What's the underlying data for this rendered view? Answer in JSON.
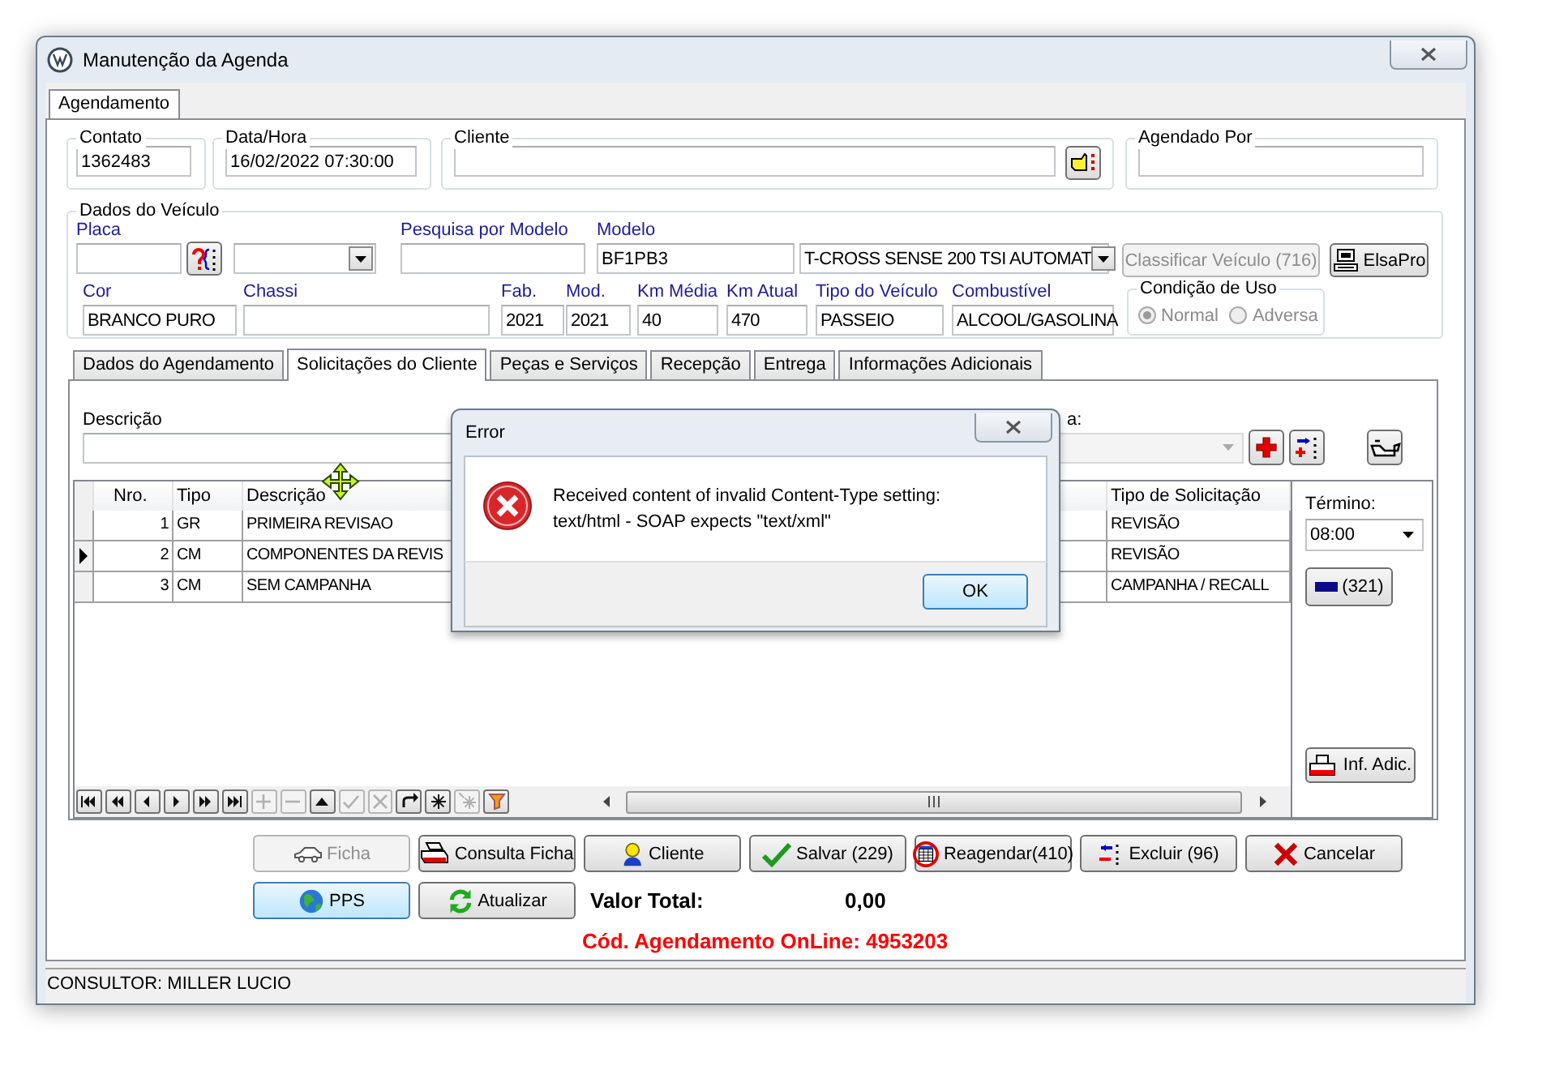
{
  "window": {
    "title": "Manutenção da Agenda"
  },
  "tabs": [
    {
      "label": "Agendamento",
      "selected": true
    }
  ],
  "contato": {
    "label": "Contato",
    "value": "1362483"
  },
  "data_hora": {
    "label": "Data/Hora",
    "value": "16/02/2022 07:30:00"
  },
  "cliente": {
    "label": "Cliente"
  },
  "agendado_por": {
    "label": "Agendado Por"
  },
  "vehicle": {
    "title": "Dados do Veículo",
    "placa": {
      "label": "Placa"
    },
    "pesquisa_modelo": {
      "label": "Pesquisa por Modelo"
    },
    "modelo": {
      "label": "Modelo",
      "value": "BF1PB3"
    },
    "modelo_descricao": {
      "value": "T-CROSS SENSE 200 TSI AUTOMAT"
    },
    "classificar_button": {
      "label": "Classificar Veículo (716)",
      "disabled": true
    },
    "elsapro_button": {
      "label": "ElsaPro",
      "disabled": false
    },
    "fields": [
      {
        "label": "Cor",
        "value": "BRANCO PURO"
      },
      {
        "label": "Chassi"
      },
      {
        "label": "Fab.",
        "value": "2021"
      },
      {
        "label": "Mod.",
        "value": "2021"
      },
      {
        "label": "Km Média",
        "value": "40"
      },
      {
        "label": "Km Atual",
        "value": "470"
      },
      {
        "label": "Tipo do Veículo",
        "value": "PASSEIO"
      },
      {
        "label": "Combustível",
        "value": "ALCOOL/GASOLINA"
      }
    ],
    "condicao_uso": {
      "title": "Condição de Uso",
      "disabled": true,
      "options": [
        {
          "label": "Normal",
          "selected": true
        },
        {
          "label": "Adversa",
          "selected": false
        }
      ]
    }
  },
  "sub_tabs": [
    {
      "label": "Dados do Agendamento",
      "selected": false
    },
    {
      "label": "Solicitações do Cliente",
      "selected": true
    },
    {
      "label": "Peças e Serviços",
      "selected": false
    },
    {
      "label": "Recepção",
      "selected": false
    },
    {
      "label": "Entrega",
      "selected": false
    },
    {
      "label": "Informações Adicionais",
      "selected": false
    }
  ],
  "solicitacoes": {
    "descricao_label": "Descrição",
    "right_label": "a:",
    "grid": {
      "columns": [
        "Nro.",
        "Tipo",
        "Descrição",
        "Tipo de Solicitação"
      ],
      "rows": [
        {
          "cells": [
            "1",
            "GR",
            "PRIMEIRA REVISAO",
            "REVISÃO"
          ],
          "current": false
        },
        {
          "cells": [
            "2",
            "CM",
            "COMPONENTES DA REVIS",
            "REVISÃO"
          ],
          "current": true
        },
        {
          "cells": [
            "3",
            "CM",
            "SEM CAMPANHA",
            "CAMPANHA / RECALL"
          ],
          "current": false
        }
      ]
    },
    "navigator": [
      {
        "kind": "first",
        "disabled": false
      },
      {
        "kind": "prior-page",
        "disabled": false
      },
      {
        "kind": "prior",
        "disabled": false
      },
      {
        "kind": "next",
        "disabled": false
      },
      {
        "kind": "next-page",
        "disabled": false
      },
      {
        "kind": "last",
        "disabled": false
      },
      {
        "kind": "insert",
        "disabled": true
      },
      {
        "kind": "delete",
        "disabled": true
      },
      {
        "kind": "edit",
        "disabled": false
      },
      {
        "kind": "post",
        "disabled": true
      },
      {
        "kind": "cancel",
        "disabled": true
      },
      {
        "kind": "refresh",
        "disabled": false
      },
      {
        "kind": "apply",
        "disabled": false
      },
      {
        "kind": "clear",
        "disabled": true
      },
      {
        "kind": "filter",
        "disabled": false
      }
    ],
    "termino": {
      "label": "Término:",
      "value": "08:00"
    },
    "count_button": {
      "label": "(321)"
    },
    "inf_button": {
      "label": "Inf. Adic."
    }
  },
  "actions": [
    [
      {
        "label": "Ficha",
        "disabled": true,
        "focused": false
      },
      {
        "label": "Consulta Ficha",
        "disabled": false,
        "focused": false
      },
      {
        "label": "Cliente",
        "disabled": false,
        "focused": false
      },
      {
        "label": "Salvar (229)",
        "disabled": false,
        "focused": false
      },
      {
        "label": "Reagendar(410)",
        "disabled": false,
        "focused": false
      },
      {
        "label": "Excluir (96)",
        "disabled": false,
        "focused": false
      },
      {
        "label": "Cancelar",
        "disabled": false,
        "focused": false
      }
    ],
    [
      {
        "label": "PPS",
        "disabled": false,
        "focused": true
      },
      {
        "label": "Atualizar",
        "disabled": false,
        "focused": false
      }
    ]
  ],
  "totals": {
    "label": "Valor Total:",
    "value": "0,00",
    "online_code": "Cód. Agendamento OnLine: 4953203"
  },
  "status_bar": {
    "text": "CONSULTOR: MILLER LUCIO"
  },
  "dialog": {
    "title": "Error",
    "message": "Received content of invalid Content-Type setting:\ntext/html - SOAP expects \"text/xml\"",
    "ok_button": "OK"
  }
}
